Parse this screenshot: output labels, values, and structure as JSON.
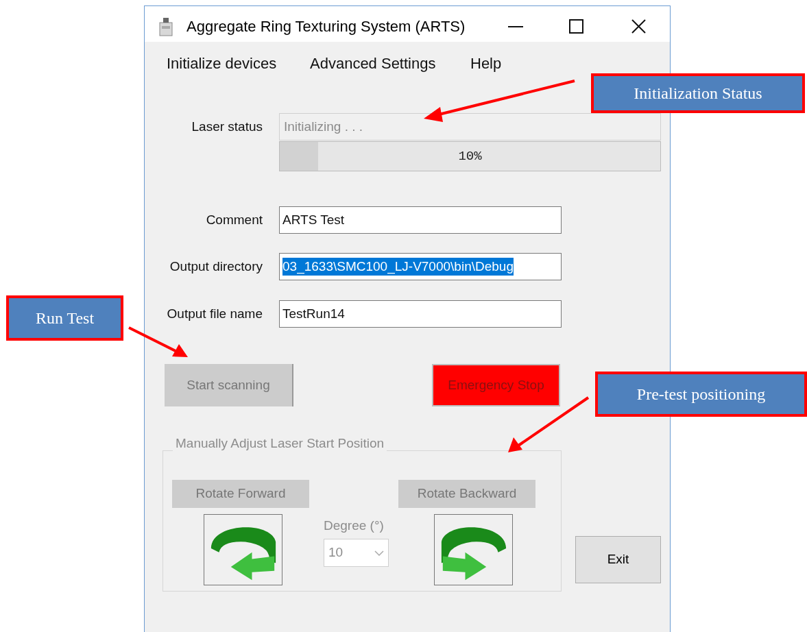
{
  "window": {
    "title": "Aggregate Ring Texturing System (ARTS)"
  },
  "menu": [
    "Initialize devices",
    "Advanced Settings",
    "Help"
  ],
  "laser_status": {
    "label": "Laser status",
    "status": "Initializing . . .",
    "progress_text": "10%",
    "level": 0.1
  },
  "fields": [
    {
      "label": "Comment",
      "value": "ARTS Test",
      "selected": false
    },
    {
      "label": "Output directory",
      "value": "03_1633\\SMC100_LJ-V7000\\bin\\Debug",
      "selected": true
    },
    {
      "label": "Output file name",
      "value": "TestRun14",
      "selected": false
    }
  ],
  "buttons": [
    {
      "kind": "start",
      "label": "Start scanning",
      "disabled": true
    },
    {
      "kind": "stop",
      "label": "Emergency Stop",
      "disabled": true
    }
  ],
  "group": {
    "title": "Manually Adjust Laser Start Position",
    "disabled": true,
    "forward": "Rotate Forward",
    "backward": "Rotate Backward",
    "degree_label": "Degree (°)",
    "degree_value": "10"
  },
  "exit": "Exit",
  "callouts": [
    {
      "text": "Initialization Status"
    },
    {
      "text": "Run Test"
    },
    {
      "text": "Pre-test positioning"
    }
  ]
}
